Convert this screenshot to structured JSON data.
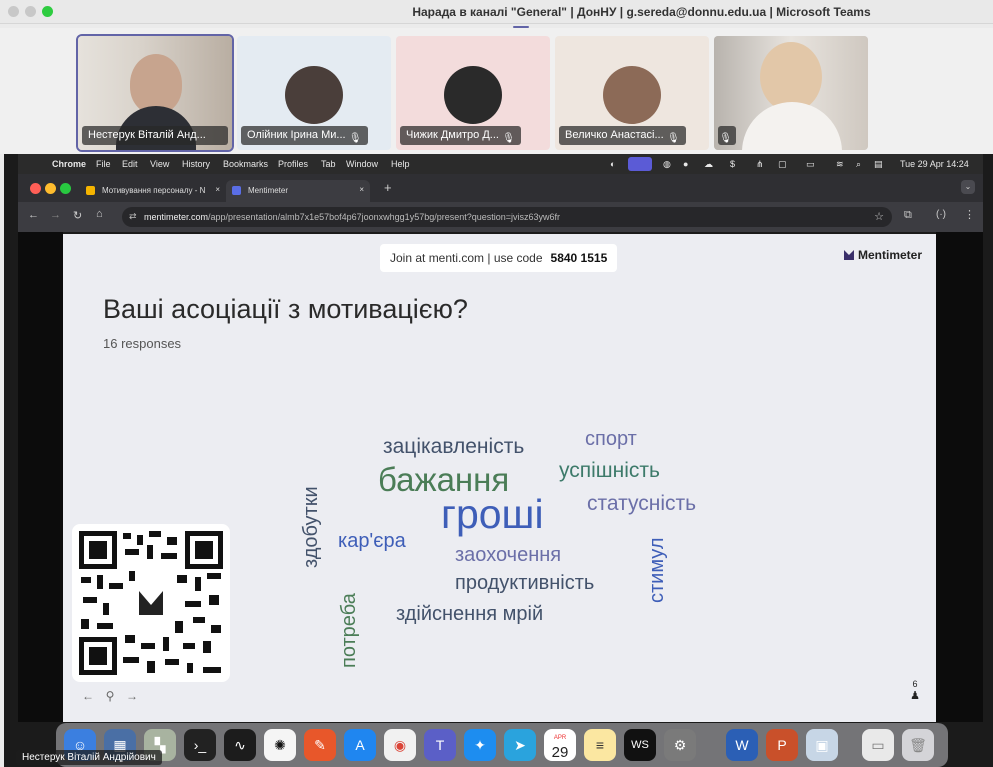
{
  "window": {
    "title": "Нарада в каналі \"General\" | ДонНУ | g.sereda@donnu.edu.ua | Microsoft Teams"
  },
  "participants": [
    {
      "name": "Нестерук Віталій Анд...",
      "muted": false
    },
    {
      "name": "Олійник Ірина Ми...",
      "muted": true
    },
    {
      "name": "Чижик Дмитро Д...",
      "muted": true
    },
    {
      "name": "Величко Анастасі...",
      "muted": true
    },
    {
      "name": "",
      "muted": true
    }
  ],
  "mac_menubar": {
    "apple": "",
    "items": [
      "Chrome",
      "File",
      "Edit",
      "View",
      "History",
      "Bookmarks",
      "Profiles",
      "Tab",
      "Window",
      "Help"
    ],
    "clock": "Tue 29 Apr  14:24"
  },
  "browser": {
    "tabs": [
      {
        "label": "Мотивування персоналу - N",
        "active": false
      },
      {
        "label": "Mentimeter",
        "active": true
      }
    ],
    "url_host": "mentimeter.com",
    "url_path": "/app/presentation/almb7x1e57bof4p67joonxwhgg1y57bg/present?question=jvisz63yw6fr"
  },
  "slide": {
    "join_text": "Join at menti.com | use code",
    "join_code": "5840 1515",
    "brand": "Mentimeter",
    "question": "Ваші асоціації з мотивацією?",
    "responses": "16 responses",
    "counter": "6",
    "words": {
      "groshi": "гроші",
      "bazhannya": "бажання",
      "zatsikavlenist": "зацікавленість",
      "sport": "спорт",
      "uspishnist": "успішність",
      "statusnist": "статусність",
      "kariera": "кар'єра",
      "zaokhochennya": "заохочення",
      "produktyvnist": "продуктивність",
      "zdiysnennya": "здійснення мрій",
      "zdobutky": "здобутки",
      "potreba": "потреба",
      "stymul": "стимул"
    }
  },
  "dock": {
    "calendar_month": "APR",
    "calendar_day": "29",
    "presenter": "Нестерук Віталій Андрійович"
  },
  "colors": {
    "teams_accent": "#6264a7",
    "green": "#4b7d57",
    "blue": "#3e5eb8",
    "slate": "#43526b",
    "purple": "#6b6fa8",
    "teal": "#3d7a6a"
  }
}
